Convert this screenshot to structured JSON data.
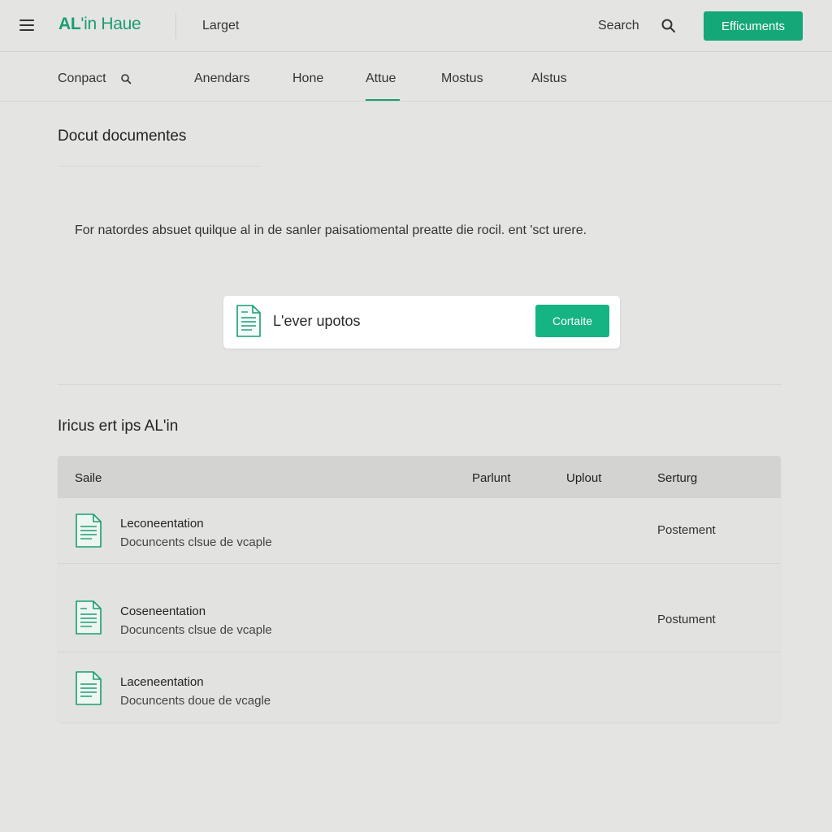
{
  "header": {
    "logo_strong": "AL",
    "logo_rest": "'in Haue",
    "context": "Larget",
    "search_label": "Search",
    "cta_label": "Efficuments"
  },
  "nav": {
    "items": [
      {
        "label": "Conpact"
      },
      {
        "label": "Anendars"
      },
      {
        "label": "Hone"
      },
      {
        "label": "Attue"
      },
      {
        "label": "Mostus"
      },
      {
        "label": "Alstus"
      }
    ],
    "active": "Attue"
  },
  "upload_section": {
    "title": "Docut documentes",
    "description": "For natordes absuet quilque al in de sanler paisatiomental preatte die rocil. ent 'sct urere.",
    "card_label": "L'ever upotos",
    "card_button": "Cortaite"
  },
  "list_section": {
    "title": "Iricus ert ips AL'in",
    "columns": [
      "Saile",
      "Parlunt",
      "Uplout",
      "Serturg"
    ],
    "rows": [
      {
        "title": "Leconeentation",
        "subtitle": "Docuncents clsue de vcaple",
        "status": "Postement"
      },
      {
        "title": "Coseneentation",
        "subtitle": "Docuncents clsue de vcaple",
        "status": "Postument"
      },
      {
        "title": "Laceneentation",
        "subtitle": "Docuncents doue de vcagle",
        "status": ""
      }
    ]
  },
  "colors": {
    "accent": "#1a9d72",
    "button": "#15a777",
    "background": "#e4e4e3",
    "table_header": "#d3d3d2"
  }
}
